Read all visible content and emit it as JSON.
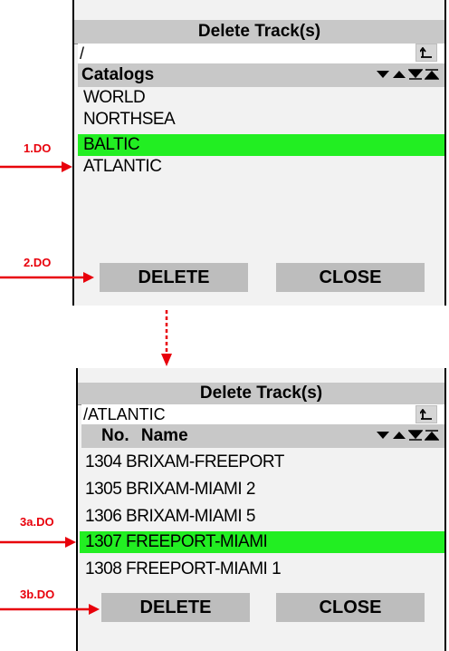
{
  "top": {
    "title": "Delete Track(s)",
    "path": "/",
    "header": "Catalogs",
    "items": [
      {
        "label": "WORLD",
        "selected": false
      },
      {
        "label": "NORTHSEA",
        "selected": false
      },
      {
        "label": "BALTIC",
        "selected": true
      },
      {
        "label": "ATLANTIC",
        "selected": false
      }
    ],
    "delete_label": "DELETE",
    "close_label": "CLOSE"
  },
  "bottom": {
    "title": "Delete Track(s)",
    "path": "/ATLANTIC",
    "header_no": "No.",
    "header_name": "Name",
    "items": [
      {
        "label": "1304 BRIXAM-FREEPORT",
        "selected": false
      },
      {
        "label": "1305 BRIXAM-MIAMI 2",
        "selected": false
      },
      {
        "label": "1306 BRIXAM-MIAMI 5",
        "selected": false
      },
      {
        "label": "1307 FREEPORT-MIAMI",
        "selected": true
      },
      {
        "label": "1308 FREEPORT-MIAMI 1",
        "selected": false
      }
    ],
    "delete_label": "DELETE",
    "close_label": "CLOSE"
  },
  "annotations": {
    "step1": "1.DO",
    "step2": "2.DO",
    "step3a": "3a.DO",
    "step3b": "3b.DO"
  },
  "colors": {
    "selection": "#22ee22",
    "annotation": "#e8000b",
    "bar": "#c8c8c8",
    "button": "#bdbdbd"
  },
  "icons": [
    "up-folder-icon",
    "sort-down-icon",
    "sort-up-icon",
    "sort-bottom-icon",
    "sort-top-icon",
    "red-arrow-icon",
    "dashed-down-arrow-icon"
  ]
}
